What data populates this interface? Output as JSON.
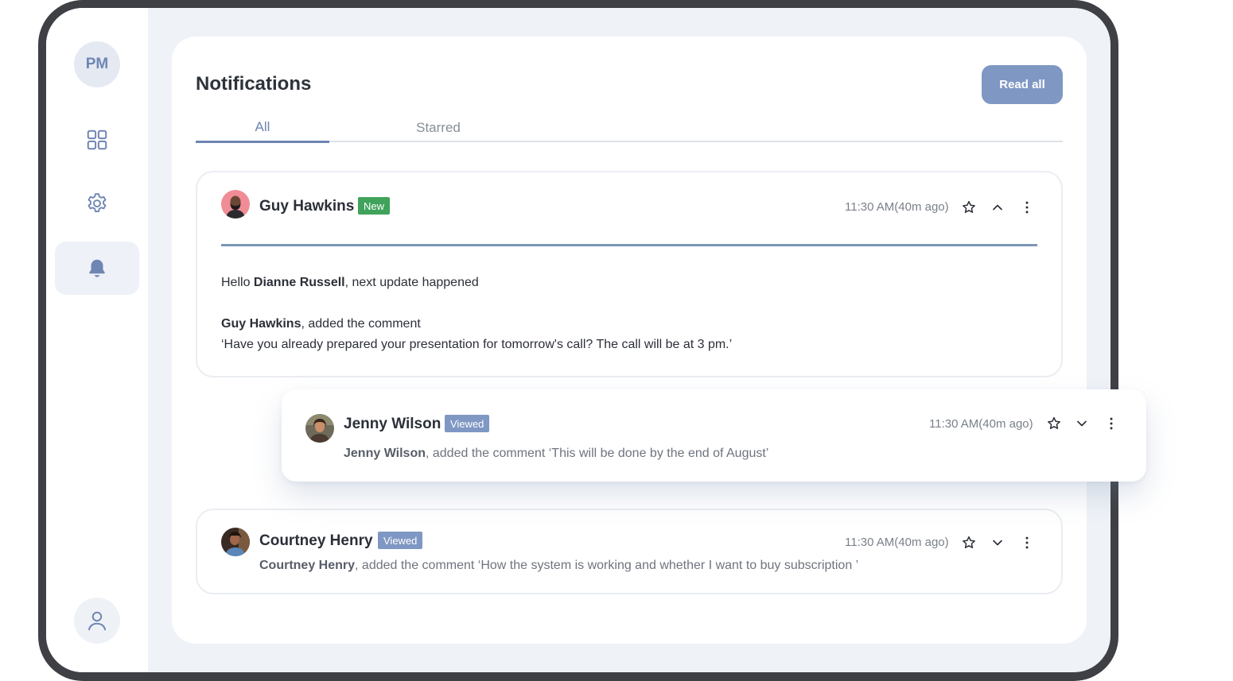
{
  "sidebar": {
    "profile_initials": "PM",
    "nav": [
      {
        "icon": "grid-icon",
        "active": false
      },
      {
        "icon": "gear-icon",
        "active": false
      },
      {
        "icon": "bell-icon",
        "active": true
      }
    ],
    "bottom_icon": "user-icon"
  },
  "header": {
    "title": "Notifications",
    "read_all_label": "Read all"
  },
  "tabs": [
    {
      "label": "All",
      "active": true
    },
    {
      "label": "Starred",
      "active": false
    }
  ],
  "notifications": [
    {
      "name": "Guy Hawkins",
      "badge": "New",
      "time": "11:30 AM(40m ago)",
      "expanded": true,
      "greeting_prefix": "Hello ",
      "greeting_name": "Dianne Russell",
      "greeting_suffix": ", next update happened",
      "actor": "Guy Hawkins",
      "action": ", added the comment",
      "quote": " ‘Have you already prepared your presentation for tomorrow's call? The call will be at 3 pm.’"
    },
    {
      "name": "Jenny Wilson",
      "badge": "Viewed",
      "time": "11:30 AM(40m ago)",
      "expanded": false,
      "actor": "Jenny Wilson",
      "action": ", added the comment  ‘This will be done by the end of August’"
    },
    {
      "name": "Courtney Henry",
      "badge": "Viewed",
      "time": "11:30 AM(40m ago)",
      "expanded": false,
      "actor": "Courtney Henry",
      "action": ", added the comment  ‘How the system is working and whether I want to buy subscription ’"
    }
  ],
  "colors": {
    "accent": "#7f97c3",
    "badge_new": "#40a35b",
    "badge_viewed": "#7f97c3",
    "divider": "#7b96b7"
  }
}
